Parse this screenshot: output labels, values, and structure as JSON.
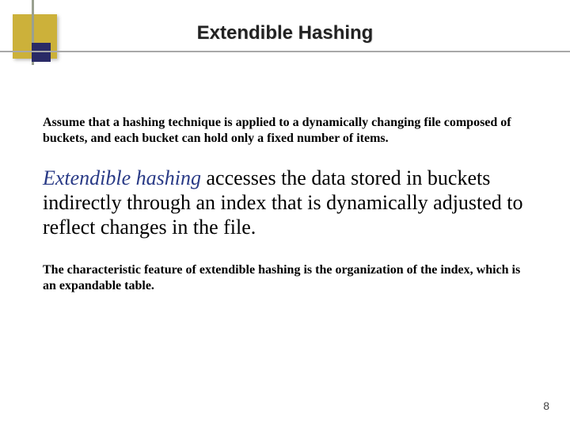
{
  "slide": {
    "title": "Extendible Hashing",
    "para1": "Assume that a hashing technique is applied to a dynamically changing file composed of buckets, and each bucket can hold only a fixed number of items.",
    "highlight_term": "Extendible hashing",
    "para2_rest": " accesses the data stored in buckets indirectly through an index that is dynamically adjusted to reflect changes in the file.",
    "para3": "The characteristic feature of extendible hashing is the organization of the index, which is an expandable table.",
    "page_number": "8"
  }
}
